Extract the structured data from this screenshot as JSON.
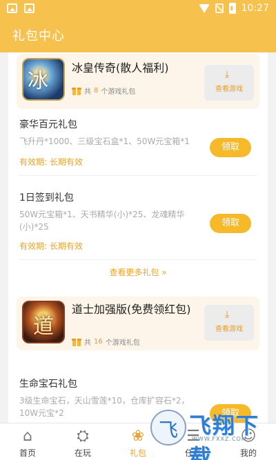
{
  "status_bar": {
    "time": "10:27"
  },
  "app_bar": {
    "title": "礼包中心"
  },
  "games": [
    {
      "icon": "game-icon-bingquan",
      "icon_glyph": "冰",
      "title": "冰皇传奇(散人福利)",
      "gift_prefix": "共",
      "gift_count": "8",
      "gift_suffix": "个游戏礼包",
      "view_label": "查看游戏",
      "packs": [
        {
          "name": "豪华百元礼包",
          "desc": "飞升丹*1000、三级宝石盒*1、50W元宝箱*1",
          "valid": "有效期: 长期有效",
          "claim": "领取"
        },
        {
          "name": "1日签到礼包",
          "desc": "50W元宝箱*1、天书精华(小)*25、龙魂精华(小)*25",
          "valid": "有效期: 长期有效",
          "claim": "领取"
        }
      ],
      "more_label": "查看更多礼包 »"
    },
    {
      "icon": "game-icon-daoshi",
      "icon_glyph": "道",
      "title": "道士加强版(免费领红包)",
      "gift_prefix": "共",
      "gift_count": "16",
      "gift_suffix": "个游戏礼包",
      "view_label": "查看游戏",
      "packs": [
        {
          "name": "生命宝石礼包",
          "desc": "3级生命宝石，天山雪莲*10，仓库扩容石*2，10W元宝*2",
          "claim": "领取"
        }
      ]
    }
  ],
  "tab_bar": {
    "tabs": [
      {
        "label": "首页",
        "icon": "home-icon"
      },
      {
        "label": "在玩",
        "icon": "playing-icon"
      },
      {
        "label": "礼包",
        "icon": "gift-tab-icon",
        "active": true
      },
      {
        "label": "任务",
        "icon": "task-icon"
      },
      {
        "label": "我的",
        "icon": "profile-icon"
      }
    ]
  },
  "watermark": {
    "text": "飞翔下载",
    "sub": "WWW.FXXZ.COM"
  },
  "colors": {
    "brand": "#f6c14c",
    "accent": "#f0a21e",
    "button": "#f6b92a"
  }
}
